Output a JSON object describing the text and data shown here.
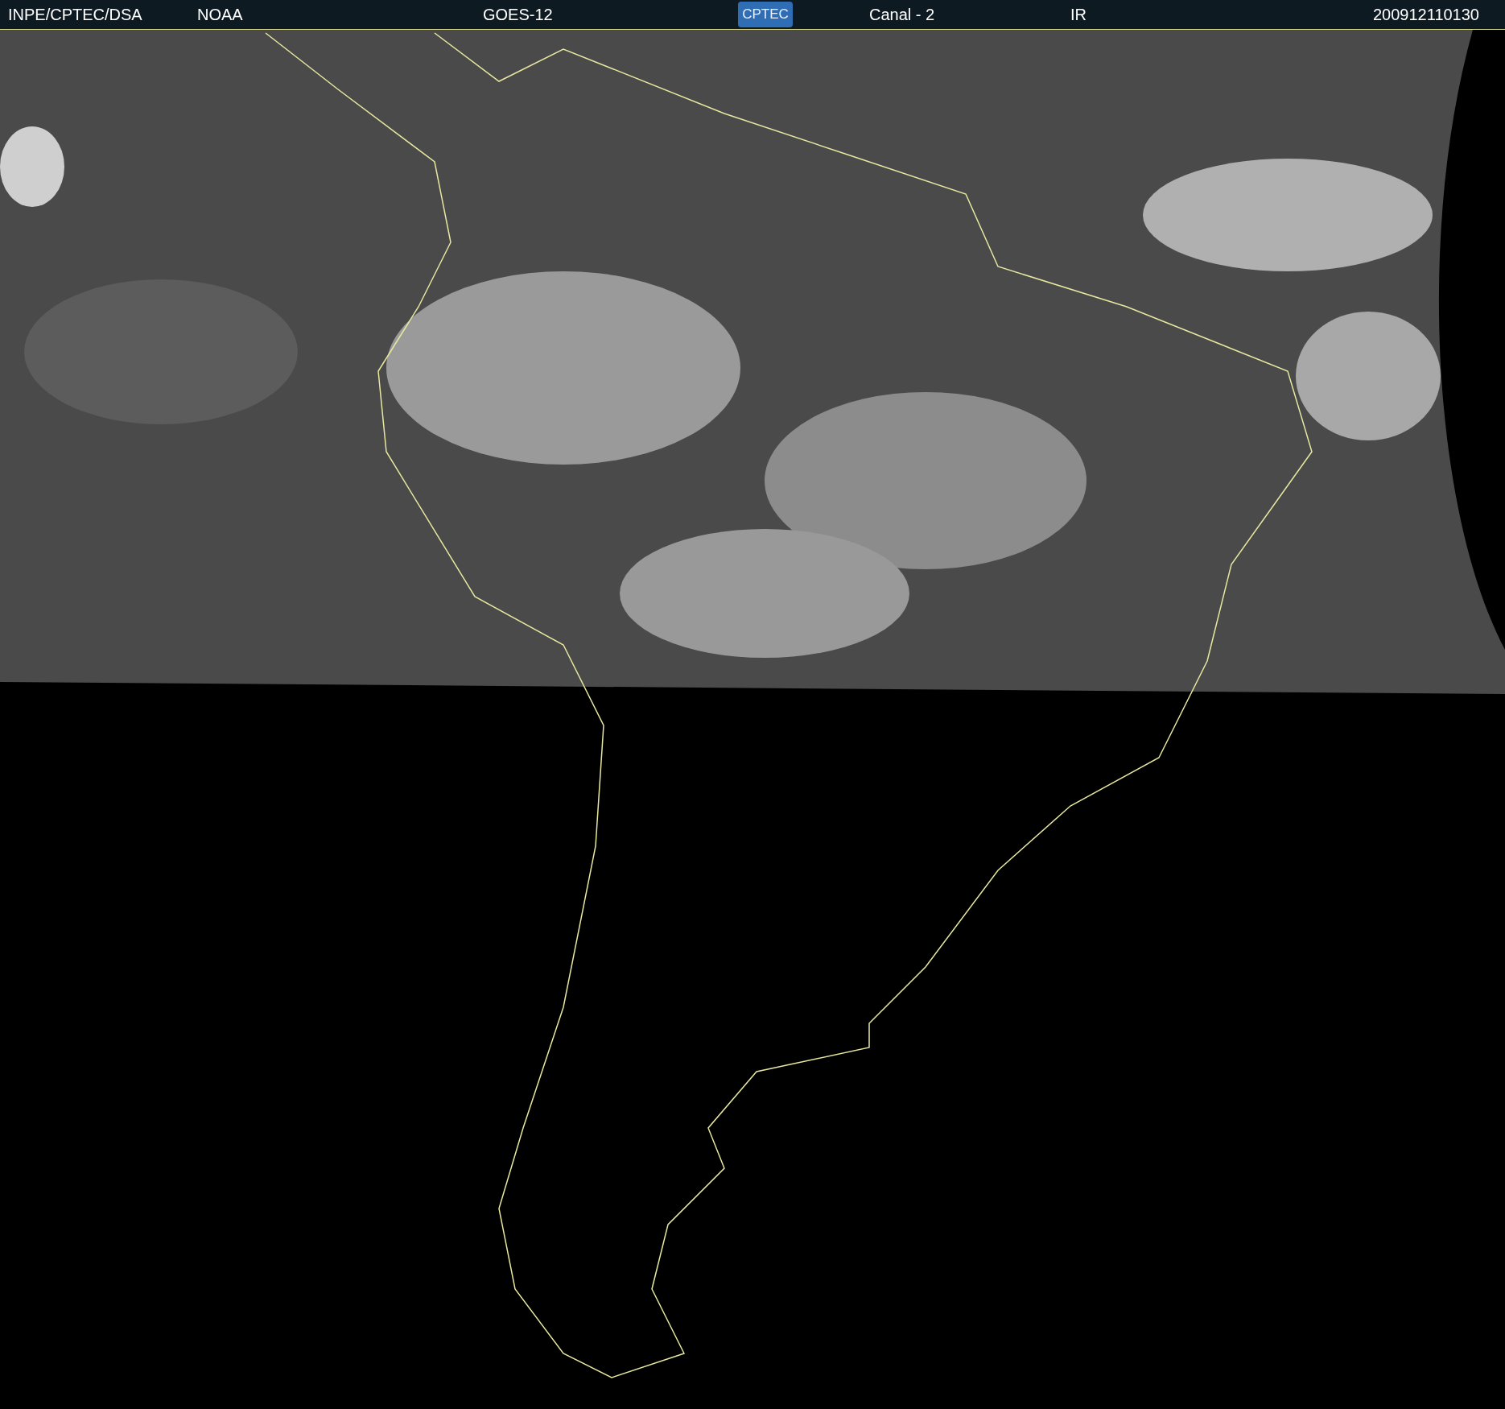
{
  "header": {
    "source": "INPE/CPTEC/DSA",
    "agency": "NOAA",
    "satellite": "GOES-12",
    "logo": "CPTEC",
    "channel": "Canal - 2",
    "band": "IR",
    "timestamp": "200912110130"
  }
}
